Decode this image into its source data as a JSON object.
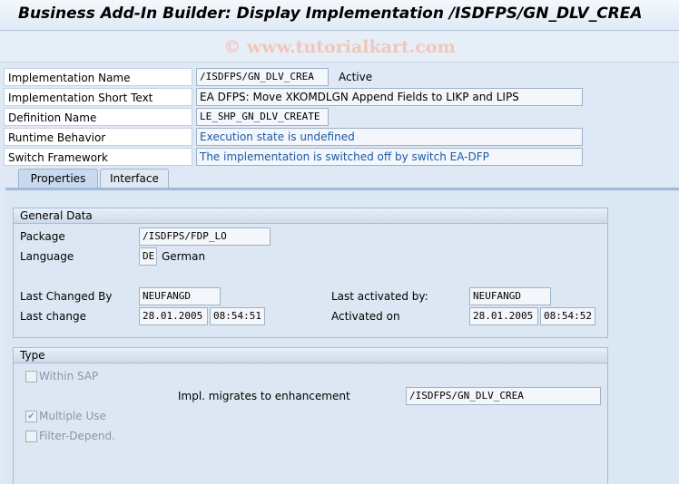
{
  "window": {
    "title": "Business Add-In Builder: Display Implementation /ISDFPS/GN_DLV_CREA"
  },
  "watermark": "© www.tutorialkart.com",
  "header": {
    "impl_name_label": "Implementation Name",
    "impl_name_value": "/ISDFPS/GN_DLV_CREA",
    "impl_status": "Active",
    "short_text_label": "Implementation Short Text",
    "short_text_value": "EA DFPS: Move XKOMDLGN Append Fields to LIKP and LIPS",
    "definition_label": "Definition Name",
    "definition_value": "LE_SHP_GN_DLV_CREATE",
    "runtime_label": "Runtime Behavior",
    "runtime_value": "Execution state is undefined",
    "switch_label": "Switch Framework",
    "switch_value": "The implementation is switched off by switch EA-DFP"
  },
  "tabs": [
    {
      "label": "Properties",
      "active": true
    },
    {
      "label": "Interface",
      "active": false
    }
  ],
  "general": {
    "title": "General Data",
    "package_label": "Package",
    "package_value": "/ISDFPS/FDP_LO",
    "language_label": "Language",
    "language_code": "DE",
    "language_name": "German",
    "changed_by_label": "Last Changed By",
    "changed_by_value": "NEUFANGD",
    "last_change_label": "Last change",
    "last_change_date": "28.01.2005",
    "last_change_time": "08:54:51",
    "activated_by_label": "Last activated by:",
    "activated_by_value": "NEUFANGD",
    "activated_on_label": "Activated on",
    "activated_on_date": "28.01.2005",
    "activated_on_time": "08:54:52"
  },
  "type": {
    "title": "Type",
    "within_sap_label": "Within SAP",
    "within_sap_checked": false,
    "migrates_label": "Impl. migrates to enhancement",
    "migrates_value": "/ISDFPS/GN_DLV_CREA",
    "multiple_use_label": "Multiple Use",
    "multiple_use_checked": true,
    "filter_label": "Filter-Depend.",
    "filter_checked": false
  },
  "icons": {
    "check": "check-icon"
  }
}
